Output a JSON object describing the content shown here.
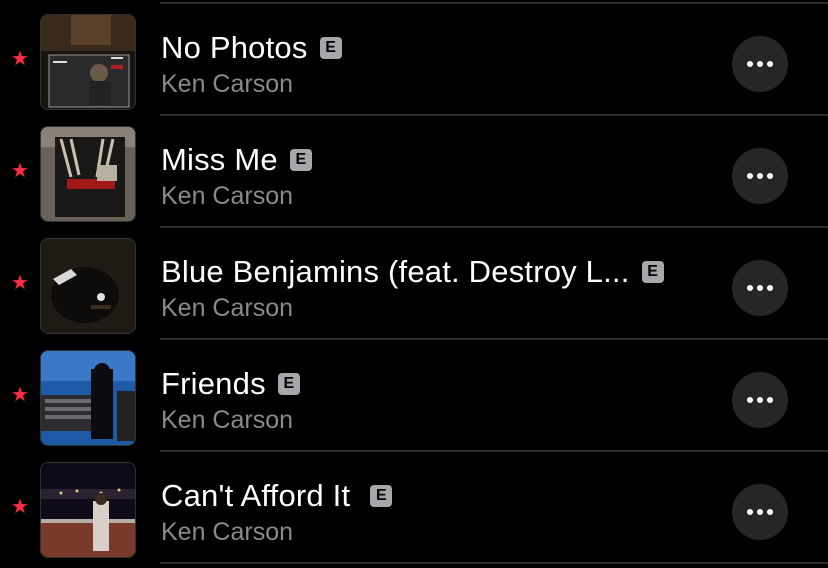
{
  "tracks": [
    {
      "title": "No Photos",
      "artist": "Ken Carson",
      "explicit": "E",
      "favorite_icon": "star-icon",
      "more_icon": "ellipsis-icon"
    },
    {
      "title": "Miss Me",
      "artist": "Ken Carson",
      "explicit": "E",
      "favorite_icon": "star-icon",
      "more_icon": "ellipsis-icon"
    },
    {
      "title": "Blue Benjamins (feat. Destroy L...",
      "artist": "Ken Carson",
      "explicit": "E",
      "favorite_icon": "star-icon",
      "more_icon": "ellipsis-icon"
    },
    {
      "title": "Friends",
      "artist": "Ken Carson",
      "explicit": "E",
      "favorite_icon": "star-icon",
      "more_icon": "ellipsis-icon"
    },
    {
      "title": "Can't Afford It",
      "artist": "Ken Carson",
      "explicit": "E",
      "favorite_icon": "star-icon",
      "more_icon": "ellipsis-icon"
    }
  ],
  "colors": {
    "background": "#000000",
    "star": "#fa2d48",
    "title": "#ffffff",
    "artist": "#8a8a8e",
    "more_button_bg": "#262629",
    "explicit_badge": "#a7a7ab",
    "divider": "#2a2a2c"
  }
}
